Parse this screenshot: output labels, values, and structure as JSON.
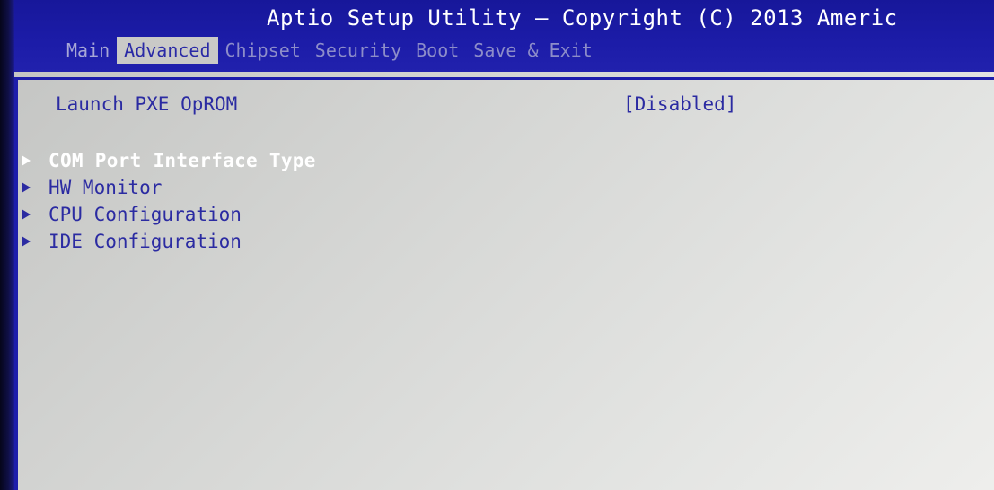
{
  "window": {
    "title": "Aptio Setup Utility – Copyright (C) 2013 Americ"
  },
  "tabs": [
    {
      "label": "Main",
      "active": false
    },
    {
      "label": "Advanced",
      "active": true
    },
    {
      "label": "Chipset",
      "active": false
    },
    {
      "label": "Security",
      "active": false
    },
    {
      "label": "Boot",
      "active": false
    },
    {
      "label": "Save & Exit",
      "active": false
    }
  ],
  "settings": [
    {
      "label": "Launch PXE OpROM",
      "value": "[Disabled]"
    }
  ],
  "submenus": [
    {
      "label": "COM Port Interface Type",
      "selected": true,
      "icon": "triangle-right-icon"
    },
    {
      "label": "HW Monitor",
      "selected": false,
      "icon": "triangle-right-icon"
    },
    {
      "label": "CPU Configuration",
      "selected": false,
      "icon": "triangle-right-icon"
    },
    {
      "label": "IDE Configuration",
      "selected": false,
      "icon": "triangle-right-icon"
    }
  ],
  "colors": {
    "header_bg": "#1c1ca8",
    "panel_bg": "#d6d7d5",
    "text_blue": "#2b2ba2",
    "highlight_text": "#ffffff",
    "inactive_tab": "#8d8dc9"
  }
}
